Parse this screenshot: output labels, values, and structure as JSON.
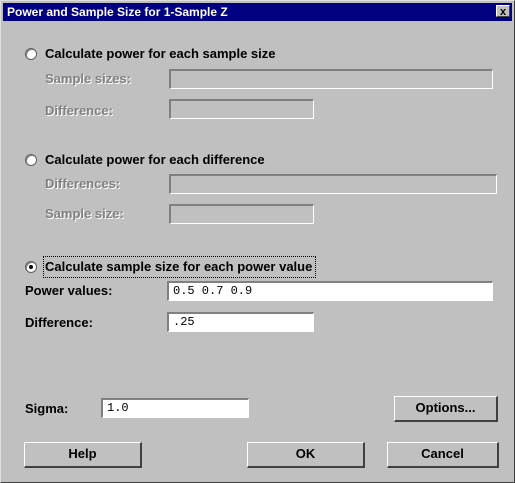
{
  "window": {
    "title": "Power and Sample Size for 1-Sample Z",
    "close_glyph": "x"
  },
  "options": [
    {
      "label": "Calculate power for each sample size",
      "selected": false,
      "fields": [
        {
          "label": "Sample sizes:",
          "value": "",
          "enabled": false
        },
        {
          "label": "Difference:",
          "value": "",
          "enabled": false
        }
      ]
    },
    {
      "label": "Calculate power for each difference",
      "selected": false,
      "fields": [
        {
          "label": "Differences:",
          "value": "",
          "enabled": false
        },
        {
          "label": "Sample size:",
          "value": "",
          "enabled": false
        }
      ]
    },
    {
      "label": "Calculate sample size for each power value",
      "selected": true,
      "fields": [
        {
          "label": "Power values:",
          "value": "0.5 0.7 0.9",
          "enabled": true
        },
        {
          "label": "Difference:",
          "value": ".25",
          "enabled": true
        }
      ]
    }
  ],
  "sigma": {
    "label": "Sigma:",
    "value": "1.0"
  },
  "buttons": {
    "options": "Options...",
    "help": "Help",
    "ok": "OK",
    "cancel": "Cancel"
  }
}
